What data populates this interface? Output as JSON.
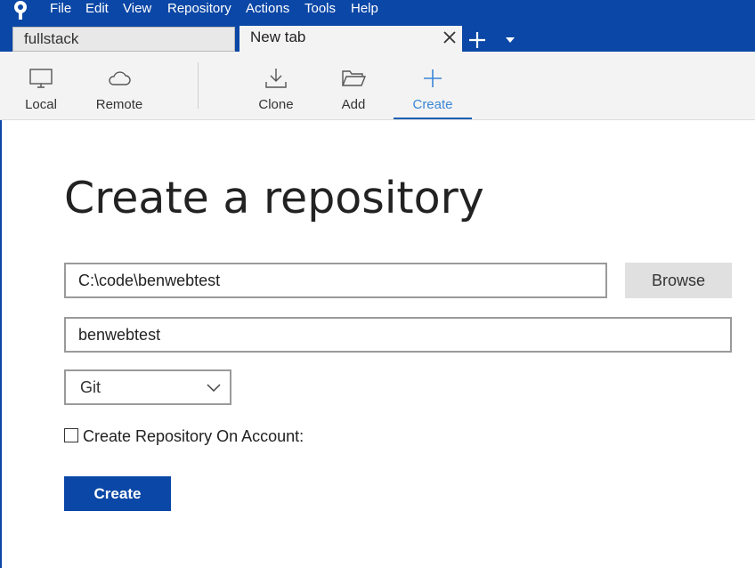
{
  "menubar": {
    "logo_icon": "sourcetree-logo-icon",
    "items": [
      "File",
      "Edit",
      "View",
      "Repository",
      "Actions",
      "Tools",
      "Help"
    ]
  },
  "tabs": {
    "items": [
      {
        "label": "fullstack",
        "active": false
      },
      {
        "label": "New tab",
        "active": true
      }
    ],
    "close_icon": "close-icon",
    "add_icon": "plus-icon",
    "menu_icon": "dropdown-arrow-icon"
  },
  "toolbar": {
    "items": [
      {
        "label": "Local",
        "icon": "monitor-icon",
        "active": false
      },
      {
        "label": "Remote",
        "icon": "cloud-icon",
        "active": false
      },
      {
        "label": "Clone",
        "icon": "download-icon",
        "active": false
      },
      {
        "label": "Add",
        "icon": "folder-open-icon",
        "active": false
      },
      {
        "label": "Create",
        "icon": "plus-icon",
        "active": true
      }
    ]
  },
  "form": {
    "title": "Create a repository",
    "path_value": "C:\\code\\benwebtest",
    "browse_label": "Browse",
    "name_value": "benwebtest",
    "vcs_selected": "Git",
    "checkbox_label": "Create Repository On Account:",
    "checkbox_checked": false,
    "create_label": "Create"
  },
  "colors": {
    "brand_blue": "#0b47a6",
    "active_tab_text": "#3a86d6"
  }
}
